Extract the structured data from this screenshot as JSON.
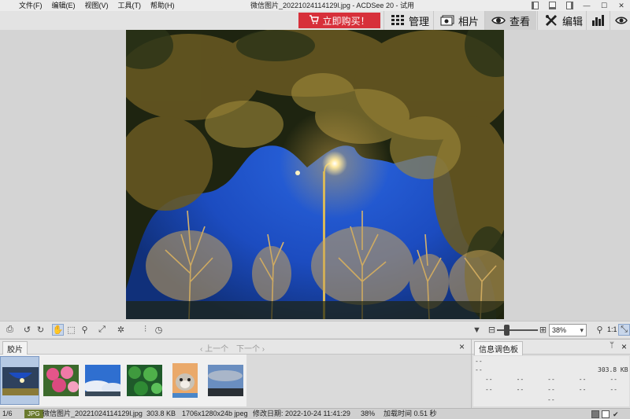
{
  "menu": {
    "items": [
      "文件(F)",
      "编辑(E)",
      "视图(V)",
      "工具(T)",
      "帮助(H)"
    ]
  },
  "window": {
    "title": "微信图片_20221024114129l.jpg - ACDSee 20 - 试用"
  },
  "modebar": {
    "buy_label": "立即购买！",
    "modes": [
      "管理",
      "相片",
      "查看",
      "编辑"
    ],
    "active_mode": "查看"
  },
  "toolbar": {
    "zoom_value": "38%",
    "ratio_label": "1:1"
  },
  "filmstrip": {
    "tab_label": "胶片",
    "prev_label": "上一个",
    "next_label": "下一个",
    "close_label": "×",
    "selected_index": 0,
    "thumb_count": 6
  },
  "info_panel": {
    "tab_label": "信息调色板",
    "pin_label": "ᛘ",
    "close_label": "×",
    "line1": "--",
    "line2_left": "--",
    "line2_right": "303.8 KB",
    "grid_row1": [
      "--",
      "--",
      "--",
      "--",
      "--"
    ],
    "grid_row2": [
      "--",
      "--",
      "--",
      "--",
      "--"
    ],
    "bottom": "--"
  },
  "status": {
    "position": "1/6",
    "format": "JPG",
    "filename": "微信图片_20221024114129l.jpg",
    "filesize": "303.8 KB",
    "dimensions": "1706x1280x24b jpeg",
    "modified": "修改日期: 2022-10-24 11:41:29",
    "zoom": "38%",
    "load_time": "加载时间 0.51 秒"
  },
  "colors": {
    "buy_button": "#d7303a",
    "format_badge": "#6a7a2e",
    "sky": "#1c4cc0"
  }
}
